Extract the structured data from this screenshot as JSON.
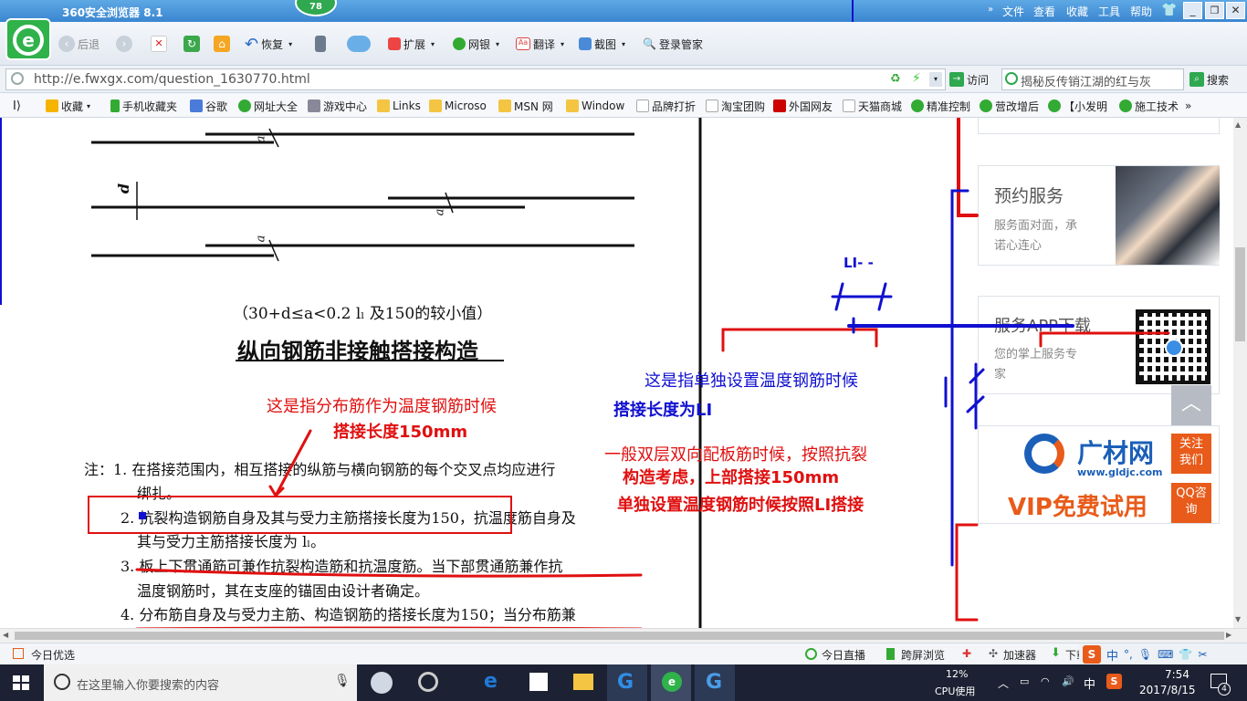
{
  "browser": {
    "title": "360安全浏览器 8.1",
    "badge": "78",
    "menu": [
      "文件",
      "查看",
      "收藏",
      "工具",
      "帮助"
    ],
    "toolbar": {
      "back": "后退",
      "restore": "恢复",
      "extend": "扩展",
      "bank": "网银",
      "translate": "翻译",
      "screenshot": "截图",
      "login_manager": "登录管家"
    },
    "address": "http://e.fwxgx.com/question_1630770.html",
    "go": "访问",
    "search_text": "揭秘反传销江湖的红与灰",
    "search_button": "搜索",
    "bookmarks": [
      "收藏",
      "手机收藏夹",
      "谷歌",
      "网址大全",
      "游戏中心",
      "Links",
      "Microso",
      "MSN 网",
      "Window",
      "品牌打折",
      "淘宝团购",
      "外国网友",
      "天猫商城",
      "精准控制",
      "营改增后",
      "【小发明",
      "施工技术"
    ],
    "status_left": "今日优选",
    "status_items": [
      "今日直播",
      "跨屏浏览",
      "加速器",
      "下载"
    ],
    "colors": {
      "accent": "#3a86d0",
      "annotation_red": "#e01010",
      "annotation_blue": "#1010d0"
    }
  },
  "document": {
    "label_a": "a",
    "label_d": "d",
    "formula": "（30+d≤a<0.2 lₗ 及150的较小值）",
    "heading": "纵向钢筋非接触搭接构造",
    "notes": [
      "注：1. 在搭接范围内，相互搭接的纵筋与横向钢筋的每个交叉点均应进行",
      "绑扎。",
      "2. 抗裂构造钢筋自身及其与受力主筋搭接长度为150，抗温度筋自身及",
      "其与受力主筋搭接长度为 lₗ。",
      "3. 板上下贯通筋可兼作抗裂构造筋和抗温度筋。当下部贯通筋兼作抗",
      "温度钢筋时，其在支座的锚固由设计者确定。",
      "4. 分布筋自身及与受力主筋、构造钢筋的搭接长度为150；当分布筋兼"
    ]
  },
  "annotations": {
    "red1_line1": "这是指分布筋作为温度钢筋时候",
    "red1_line2": "搭接长度150mm",
    "blue1_line1": "这是指单独设置温度钢筋时候",
    "blue1_line2": "搭接长度为LI",
    "red2_line1": "一般双层双向配板筋时候，按照抗裂",
    "red2_line2": "构造考虑，上部搭接150mm",
    "red2_line3": "单独设置温度钢筋时候按照LI搭接",
    "li_top": "LI- -",
    "li_right": "LI"
  },
  "sidebar": {
    "card1_title": "预约服务",
    "card1_desc1": "服务面对面，承",
    "card1_desc2": "诺心连心",
    "card2_title": "服务APP下载",
    "card2_desc1": "您的掌上服务专",
    "card2_desc2": "家",
    "ad_brand": "广材网",
    "ad_url": "www.gldjc.com",
    "ad_slogan": "VIP免费试用",
    "follow_btn": "关注我们",
    "qq_btn": "QQ咨询"
  },
  "taskbar": {
    "search_placeholder": "在这里输入你要搜索的内容",
    "cpu_pct": "12%",
    "cpu_label": "CPU使用",
    "ime": "中",
    "time": "7:54",
    "date": "2017/8/15",
    "notif_count": "4"
  }
}
